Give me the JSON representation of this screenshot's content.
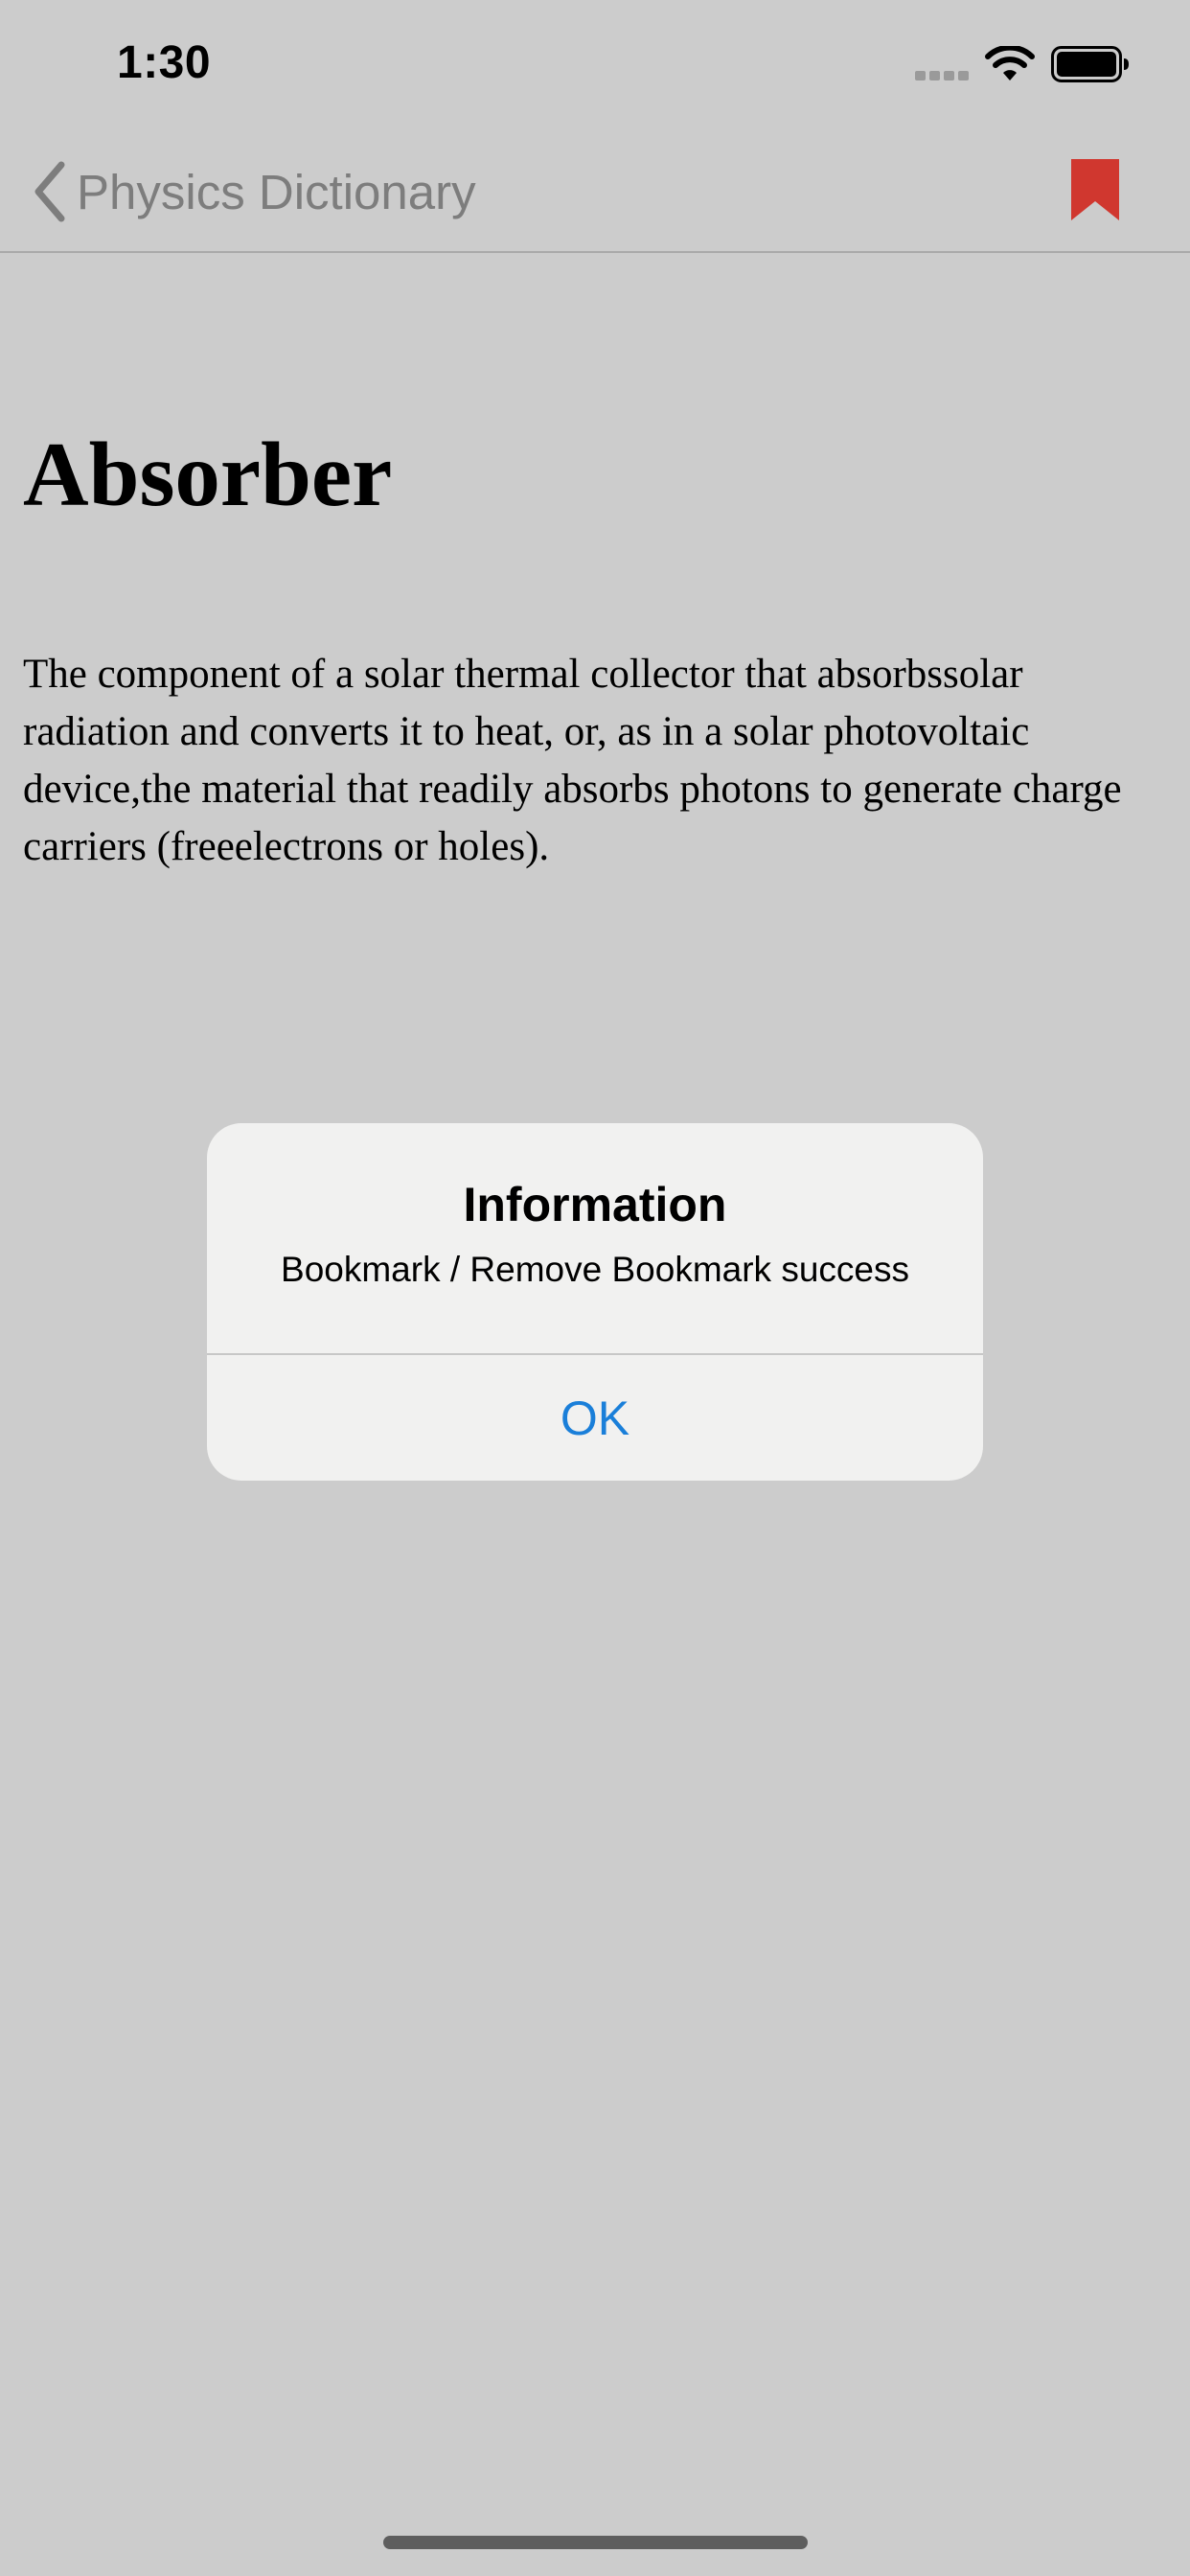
{
  "status_bar": {
    "time": "1:30",
    "icons": [
      "signal-icon",
      "wifi-icon",
      "battery-icon"
    ]
  },
  "nav_bar": {
    "back_label": "Physics Dictionary",
    "back_icon": "chevron-left-icon",
    "bookmark_icon": "bookmark-icon",
    "bookmark_color": "#d0372f"
  },
  "entry": {
    "title": "Absorber",
    "definition": "The component of a solar thermal collector that absorbssolar radiation and converts it to heat, or, as in a solar photovoltaic device,the material that readily absorbs photons to generate charge carriers (freeelectrons or holes)."
  },
  "alert": {
    "title": "Information",
    "message": "Bookmark / Remove Bookmark success",
    "ok_label": "OK",
    "accent_color": "#1a7fd9"
  }
}
